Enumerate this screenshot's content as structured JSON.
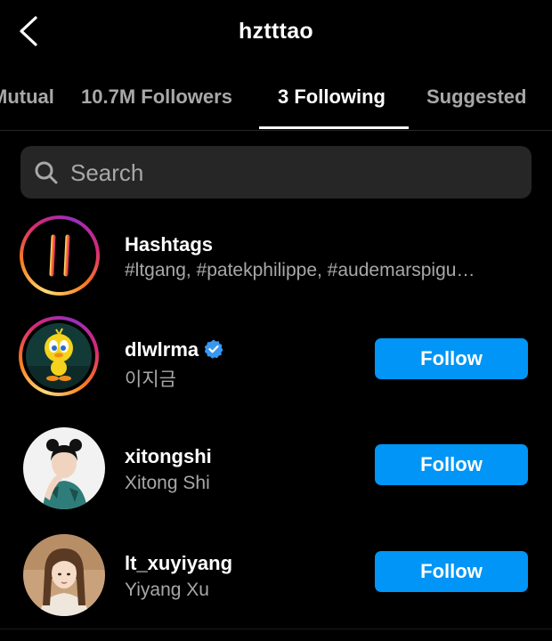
{
  "header": {
    "title": "hztttao",
    "back_icon": "chevron-left-icon"
  },
  "tabs": [
    {
      "label": "Mutual",
      "active": false
    },
    {
      "label": "10.7M Followers",
      "active": false
    },
    {
      "label": "3 Following",
      "active": true
    },
    {
      "label": "Suggested",
      "active": false
    }
  ],
  "search": {
    "placeholder": "Search",
    "value": "",
    "icon": "search-icon"
  },
  "list": [
    {
      "name": "Hashtags",
      "subtitle": "#ltgang, #patekphilippe, #audemarspigu…",
      "icon": "hashtag-icon"
    },
    {
      "name": "dlwlrma",
      "subtitle": "이지금",
      "verified": true,
      "button": "Follow"
    },
    {
      "name": "xitongshi",
      "subtitle": "Xitong Shi",
      "button": "Follow"
    },
    {
      "name": "lt_xuyiyang",
      "subtitle": "Yiyang Xu",
      "button": "Follow"
    }
  ],
  "colors": {
    "background": "#000000",
    "follow_button": "#0095f6",
    "secondary_text": "#a8a8a8",
    "search_bg": "#262626",
    "verified_badge": "#3897f0"
  }
}
